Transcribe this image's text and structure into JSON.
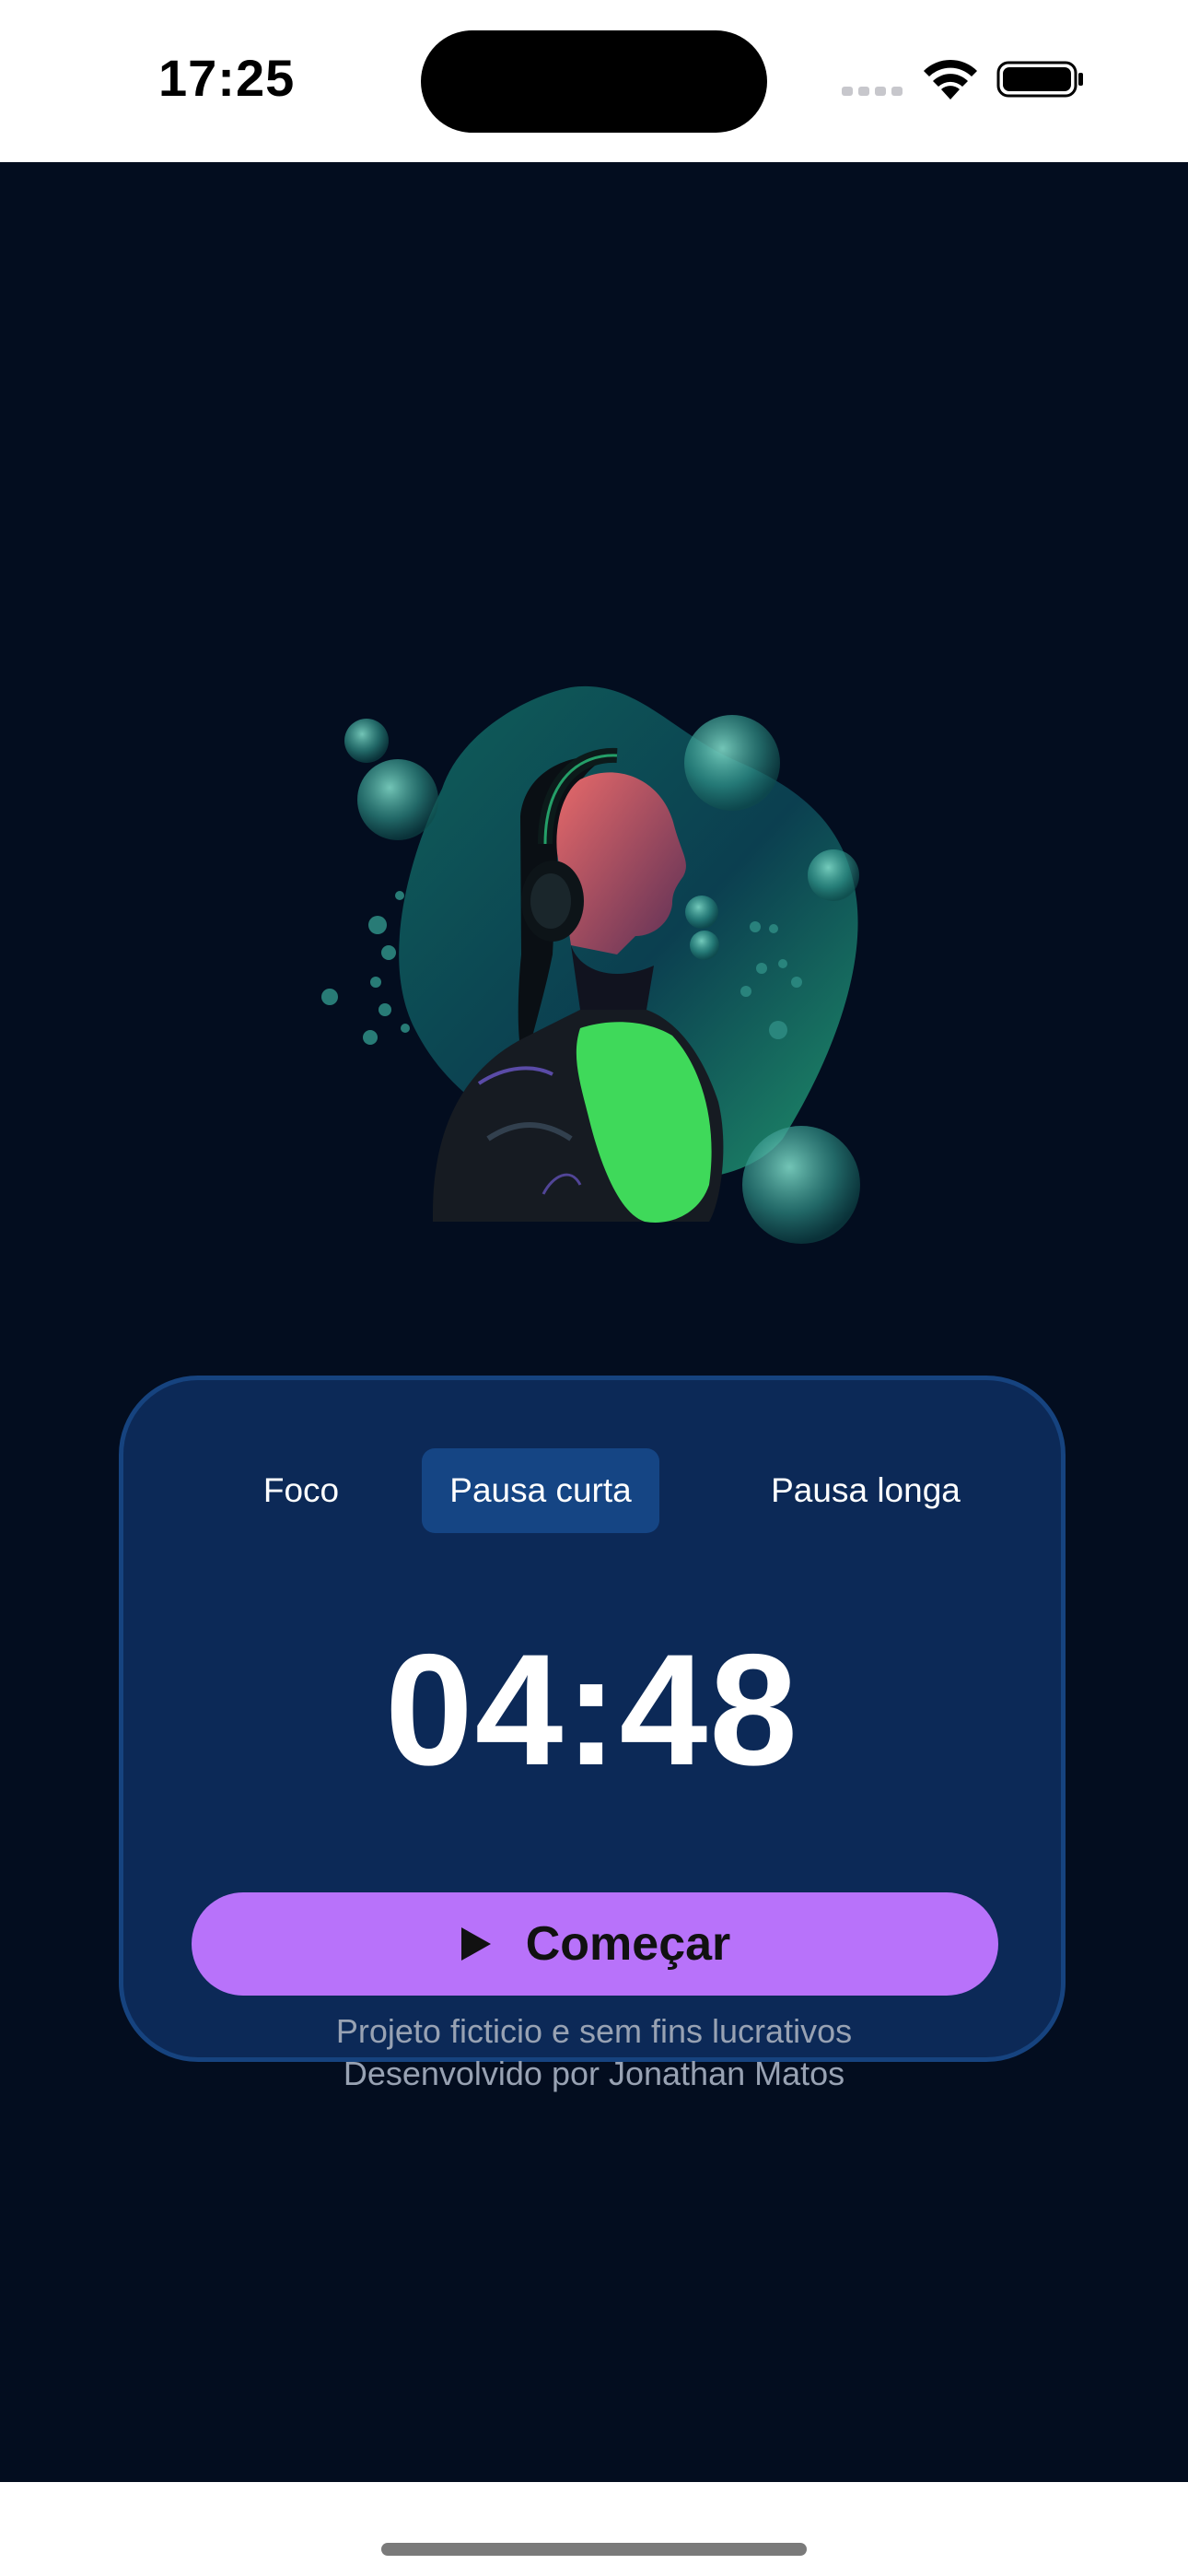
{
  "status_bar": {
    "time": "17:25"
  },
  "hero": {
    "icon": "woman-with-headphones-illustration"
  },
  "timer_card": {
    "tabs": [
      {
        "label": "Foco",
        "active": false
      },
      {
        "label": "Pausa curta",
        "active": true
      },
      {
        "label": "Pausa longa",
        "active": false
      }
    ],
    "time": "04:48",
    "start_button": {
      "label": "Começar",
      "icon": "play-icon"
    }
  },
  "footer": {
    "line1": "Projeto ficticio e sem fins lucrativos",
    "line2": "Desenvolvido por Jonathan Matos"
  },
  "colors": {
    "background": "#030d1f",
    "card": "#0c2957",
    "card_border": "#16437f",
    "active_tab": "#154584",
    "button": "#b872fa",
    "accent_green": "#3fd95a"
  }
}
